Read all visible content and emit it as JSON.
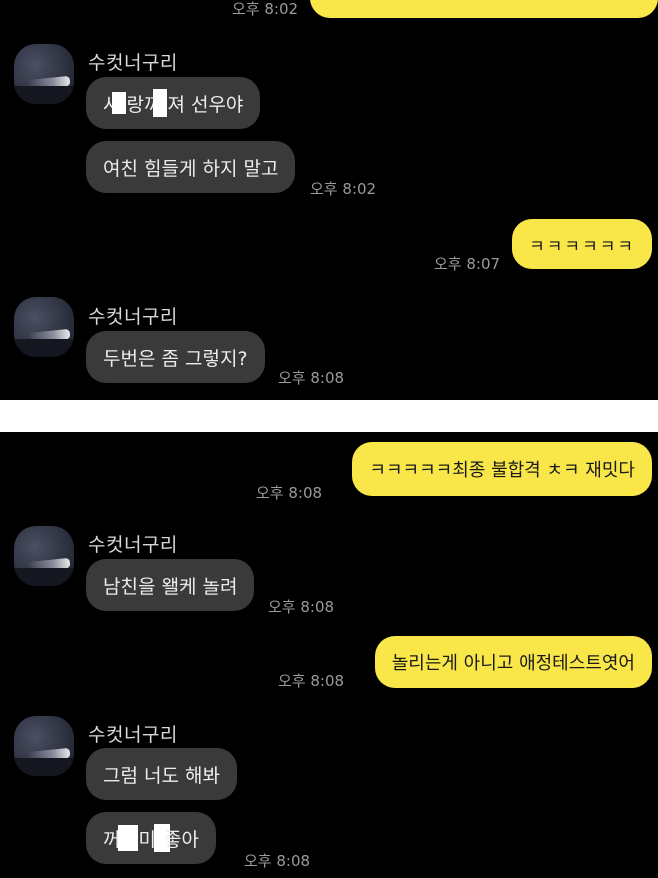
{
  "contact_name": "수컷너구리",
  "panel1": {
    "top_time": "오후 8:02",
    "msg1_a": "사",
    "msg1_b": "랑 ",
    "msg1_c": "꺼",
    "msg1_d": "져 선우야",
    "msg2": "여친 힘들게 하지 말고",
    "msg2_time": "오후 8:02",
    "out1": "ㅋㅋㅋㅋㅋㅋ",
    "out1_time": "오후 8:07",
    "msg3": "두번은 좀 그렇지?",
    "msg3_time": "오후 8:08"
  },
  "panel2": {
    "out1": "ㅋㅋㅋㅋㅋ최종 불합격 ㅊㅋ 재밋다",
    "out1_time": "오후 8:08",
    "msg1": "남친을 왤케 놀려",
    "msg1_time": "오후 8:08",
    "out2": "놀리는게 아니고 애정테스트엿어",
    "out2_time": "오후 8:08",
    "msg2": "그럼 너도 해봐",
    "msg3_a": "꺼",
    "msg3_b": " 미",
    "msg3_c": "좋아",
    "msg3_time": "오후 8:08"
  }
}
